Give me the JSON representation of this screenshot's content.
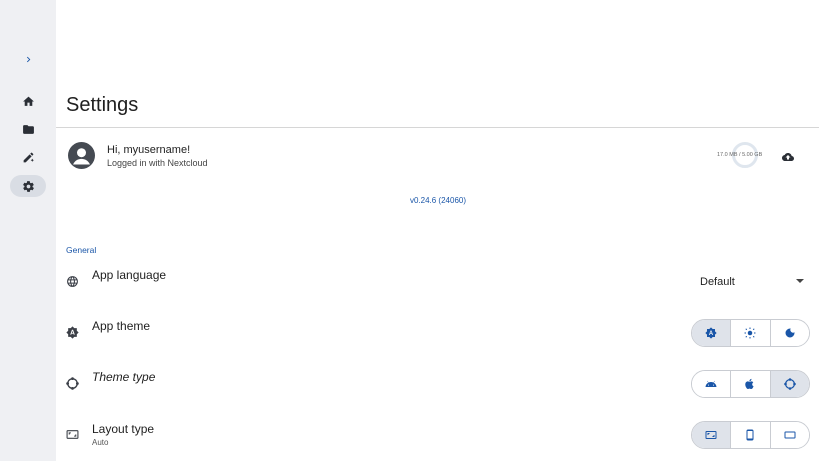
{
  "nav": {
    "items": [
      {
        "name": "expand",
        "icon": "chevron-right-icon"
      },
      {
        "name": "home",
        "icon": "home-icon"
      },
      {
        "name": "files",
        "icon": "folder-icon"
      },
      {
        "name": "edit",
        "icon": "edit-icon"
      },
      {
        "name": "settings",
        "icon": "gear-icon",
        "active": true
      }
    ]
  },
  "page": {
    "title": "Settings"
  },
  "account": {
    "greeting": "Hi, myusername!",
    "status": "Logged in with Nextcloud",
    "quota": "17.0 MB / 5.00 GB",
    "quota_fraction": 0.0034
  },
  "version": "v0.24.6 (24060)",
  "general": {
    "section_title": "General",
    "language": {
      "label": "App language",
      "value": "Default"
    },
    "app_theme": {
      "label": "App theme",
      "options": [
        "auto-theme-icon",
        "sun-icon",
        "moon-icon"
      ],
      "selected": 0
    },
    "theme_type": {
      "label": "Theme type",
      "options": [
        "android-icon",
        "apple-icon",
        "material-icon"
      ],
      "selected": 2
    },
    "layout_type": {
      "label": "Layout type",
      "sub": "Auto",
      "options": [
        "tablet-landscape-icon",
        "phone-icon",
        "desktop-icon"
      ],
      "selected": 0
    }
  },
  "colors": {
    "accent": "#1a56a8",
    "rail": "#eff0f3",
    "selected_segment": "#dfe3ea"
  }
}
